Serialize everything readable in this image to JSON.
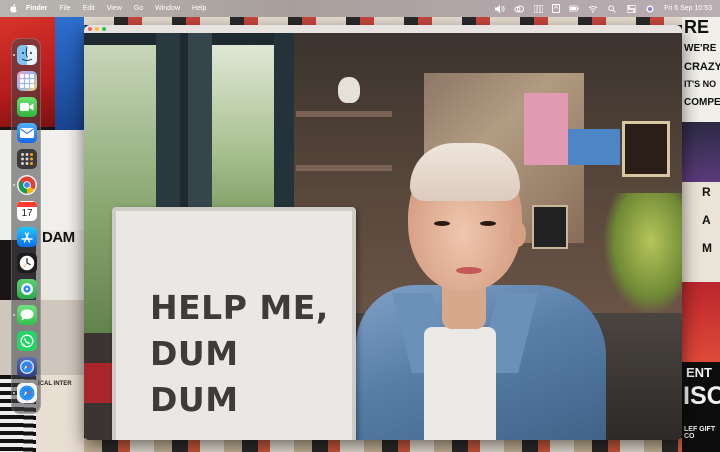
{
  "menubar": {
    "app_name": "Finder",
    "menus": [
      "File",
      "Edit",
      "View",
      "Go",
      "Window",
      "Help"
    ],
    "input_source_label": "A",
    "datetime": "Fri 6 Sep  10:53"
  },
  "dock": {
    "apps": [
      {
        "name": "Finder",
        "icon": "finder-icon"
      },
      {
        "name": "Launchpad",
        "icon": "launchpad-icon"
      },
      {
        "name": "FaceTime",
        "icon": "facetime-icon"
      },
      {
        "name": "Mail",
        "icon": "mail-icon"
      },
      {
        "name": "Calculator",
        "icon": "calculator-icon"
      },
      {
        "name": "Chrome",
        "icon": "chrome-icon"
      },
      {
        "name": "Calendar",
        "icon": "calendar-icon",
        "date_label": "17"
      },
      {
        "name": "App Store",
        "icon": "app-store-icon"
      },
      {
        "name": "Clock",
        "icon": "clock-icon"
      },
      {
        "name": "Find My",
        "icon": "find-my-icon"
      },
      {
        "name": "Messages",
        "icon": "messages-icon"
      },
      {
        "name": "WhatsApp",
        "icon": "whatsapp-icon"
      },
      {
        "name": "Safari Technology Preview",
        "icon": "safari-preview-icon"
      },
      {
        "name": "Safari",
        "icon": "safari-icon"
      }
    ]
  },
  "window": {
    "sign_line_1": "HELP ME,",
    "sign_line_2": "DUM DUM"
  },
  "wallpaper": {
    "left_poster_text": "DAM",
    "left_small_text": "ICAL INTER",
    "right_poster_lines": [
      "RE",
      "WE'RE",
      "CRAZY",
      "IT'S NO",
      "COMPE"
    ],
    "right_mid_letters": [
      "R",
      "A",
      "M"
    ],
    "right_bottom_lines": [
      "ENT",
      "ISO",
      "LEF GIFT CO"
    ]
  },
  "colors": {
    "traffic_close": "#ff5f57",
    "traffic_minimize": "#febc2e",
    "traffic_zoom": "#28c840"
  }
}
